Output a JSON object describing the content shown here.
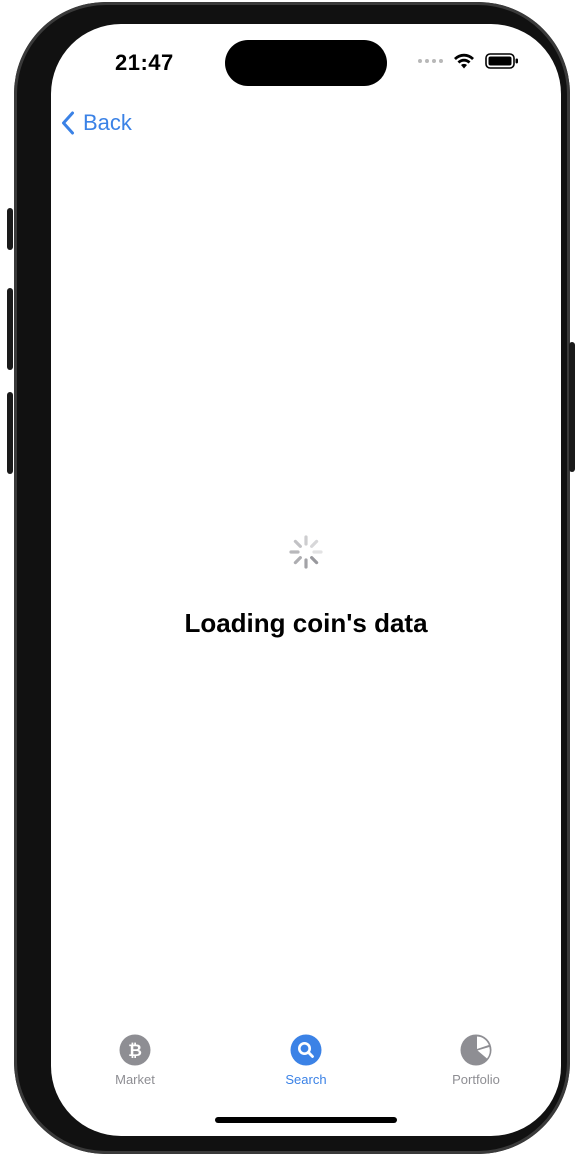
{
  "status_bar": {
    "time": "21:47",
    "wifi_icon": "wifi-icon",
    "battery_icon": "battery-icon"
  },
  "nav": {
    "back_label": "Back",
    "back_icon": "chevron-left-icon"
  },
  "main": {
    "loading_text": "Loading coin's data",
    "spinner_icon": "activity-spinner-icon"
  },
  "tabbar": {
    "tabs": [
      {
        "label": "Market",
        "icon": "bitcoin-icon",
        "active": false
      },
      {
        "label": "Search",
        "icon": "search-icon",
        "active": true
      },
      {
        "label": "Portfolio",
        "icon": "pie-chart-icon",
        "active": false
      }
    ]
  },
  "colors": {
    "accent": "#3b82e6",
    "inactive": "#8e8e93"
  }
}
